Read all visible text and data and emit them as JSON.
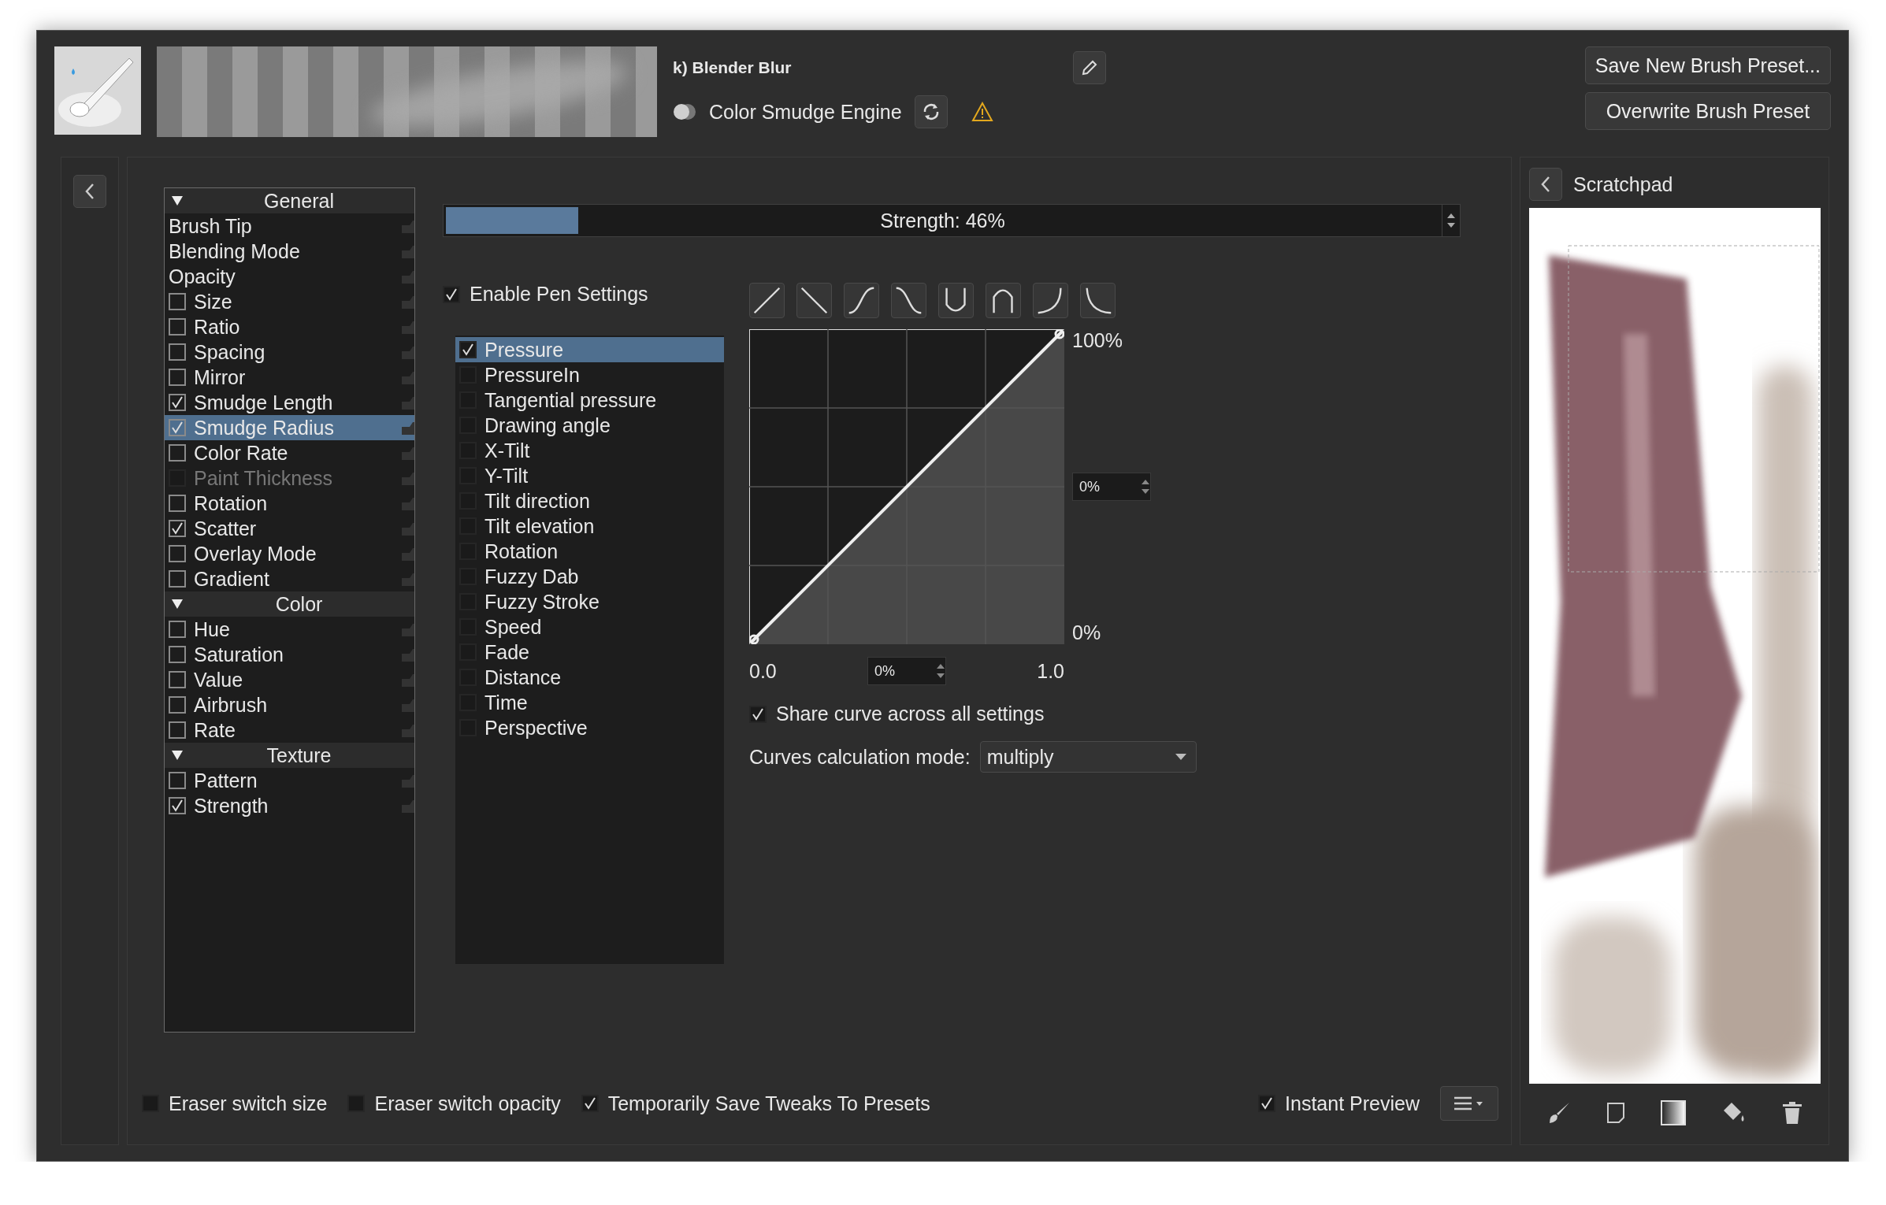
{
  "preset": {
    "name": "k) Blender Blur",
    "engine": "Color Smudge Engine"
  },
  "buttons": [
    "Save New Brush Preset...",
    "Overwrite Brush Preset"
  ],
  "options": [
    {
      "kind": "header",
      "label": "General",
      "expanded": true
    },
    {
      "kind": "plain",
      "label": "Brush Tip",
      "selected": false
    },
    {
      "kind": "plain",
      "label": "Blending Mode",
      "selected": false
    },
    {
      "kind": "plain",
      "label": "Opacity",
      "selected": false
    },
    {
      "kind": "check",
      "label": "Size",
      "checked": false,
      "selected": false,
      "disabled": false
    },
    {
      "kind": "check",
      "label": "Ratio",
      "checked": false,
      "selected": false,
      "disabled": false
    },
    {
      "kind": "check",
      "label": "Spacing",
      "checked": false,
      "selected": false,
      "disabled": false
    },
    {
      "kind": "check",
      "label": "Mirror",
      "checked": false,
      "selected": false,
      "disabled": false
    },
    {
      "kind": "check",
      "label": "Smudge Length",
      "checked": true,
      "selected": false,
      "disabled": false
    },
    {
      "kind": "check",
      "label": "Smudge Radius",
      "checked": true,
      "selected": true,
      "disabled": false
    },
    {
      "kind": "check",
      "label": "Color Rate",
      "checked": false,
      "selected": false,
      "disabled": false
    },
    {
      "kind": "check",
      "label": "Paint Thickness",
      "checked": false,
      "selected": false,
      "disabled": true
    },
    {
      "kind": "check",
      "label": "Rotation",
      "checked": false,
      "selected": false,
      "disabled": false
    },
    {
      "kind": "check",
      "label": "Scatter",
      "checked": true,
      "selected": false,
      "disabled": false
    },
    {
      "kind": "check",
      "label": "Overlay Mode",
      "checked": false,
      "selected": false,
      "disabled": false
    },
    {
      "kind": "check",
      "label": "Gradient",
      "checked": false,
      "selected": false,
      "disabled": false
    },
    {
      "kind": "header",
      "label": "Color",
      "expanded": true
    },
    {
      "kind": "check",
      "label": "Hue",
      "checked": false,
      "selected": false,
      "disabled": false
    },
    {
      "kind": "check",
      "label": "Saturation",
      "checked": false,
      "selected": false,
      "disabled": false
    },
    {
      "kind": "check",
      "label": "Value",
      "checked": false,
      "selected": false,
      "disabled": false
    },
    {
      "kind": "check",
      "label": "Airbrush",
      "checked": false,
      "selected": false,
      "disabled": false
    },
    {
      "kind": "check",
      "label": "Rate",
      "checked": false,
      "selected": false,
      "disabled": false
    },
    {
      "kind": "header",
      "label": "Texture",
      "expanded": true
    },
    {
      "kind": "check",
      "label": "Pattern",
      "checked": false,
      "selected": false,
      "disabled": false
    },
    {
      "kind": "check",
      "label": "Strength",
      "checked": true,
      "selected": false,
      "disabled": false
    }
  ],
  "strength": {
    "label": "Strength: 46%",
    "level": 0.15
  },
  "enable_pen_settings": {
    "label": "Enable Pen Settings",
    "checked": true
  },
  "sensors": [
    {
      "label": "Pressure",
      "checked": true,
      "selected": true
    },
    {
      "label": "PressureIn",
      "checked": false,
      "selected": false
    },
    {
      "label": "Tangential pressure",
      "checked": false,
      "selected": false
    },
    {
      "label": "Drawing angle",
      "checked": false,
      "selected": false
    },
    {
      "label": "X-Tilt",
      "checked": false,
      "selected": false
    },
    {
      "label": "Y-Tilt",
      "checked": false,
      "selected": false
    },
    {
      "label": "Tilt direction",
      "checked": false,
      "selected": false
    },
    {
      "label": "Tilt elevation",
      "checked": false,
      "selected": false
    },
    {
      "label": "Rotation",
      "checked": false,
      "selected": false
    },
    {
      "label": "Fuzzy Dab",
      "checked": false,
      "selected": false
    },
    {
      "label": "Fuzzy Stroke",
      "checked": false,
      "selected": false
    },
    {
      "label": "Speed",
      "checked": false,
      "selected": false
    },
    {
      "label": "Fade",
      "checked": false,
      "selected": false
    },
    {
      "label": "Distance",
      "checked": false,
      "selected": false
    },
    {
      "label": "Time",
      "checked": false,
      "selected": false
    },
    {
      "label": "Perspective",
      "checked": false,
      "selected": false
    }
  ],
  "curve": {
    "y_max": "100%",
    "y_min": "0%",
    "y_value": "0%",
    "x_min": "0.0",
    "x_value": "0%",
    "x_max": "1.0"
  },
  "share_curve": {
    "label": "Share curve across all settings",
    "checked": true
  },
  "curves_mode": {
    "label": "Curves calculation mode:",
    "value": "multiply"
  },
  "footer": {
    "options": [
      {
        "label": "Eraser switch size",
        "checked": false
      },
      {
        "label": "Eraser switch opacity",
        "checked": false
      },
      {
        "label": "Temporarily Save Tweaks To Presets",
        "checked": true
      }
    ],
    "instant_preview": {
      "label": "Instant Preview",
      "checked": true
    }
  },
  "scratchpad": {
    "title": "Scratchpad"
  }
}
